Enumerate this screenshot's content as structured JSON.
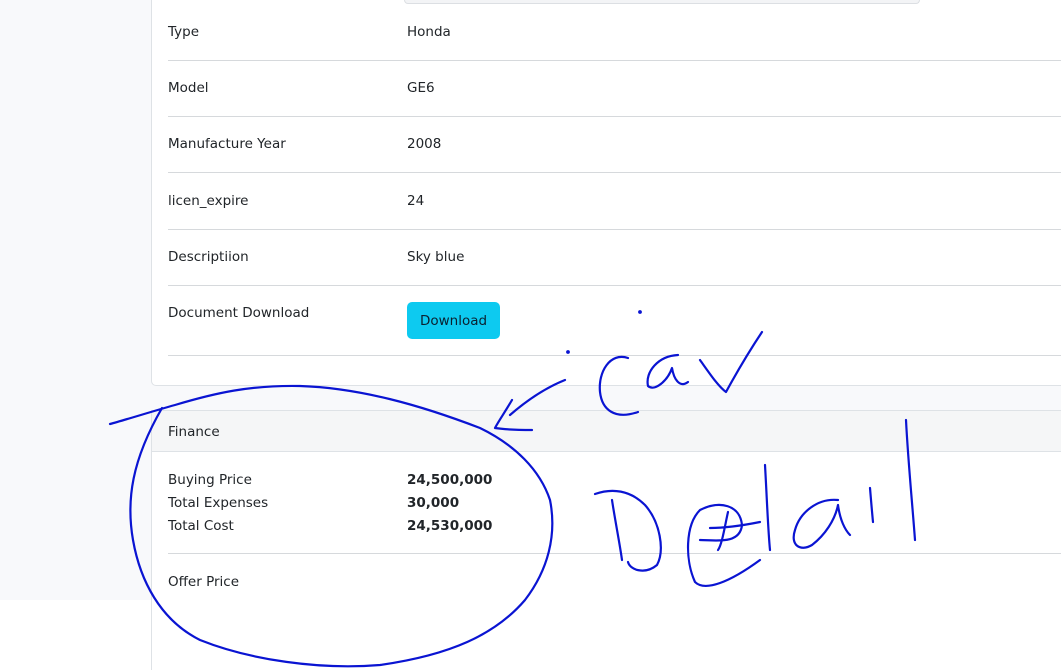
{
  "car_details": {
    "rows": [
      {
        "label": "Type",
        "value": "Honda"
      },
      {
        "label": "Model",
        "value": "GE6"
      },
      {
        "label": "Manufacture Year",
        "value": "2008"
      },
      {
        "label": "licen_expire",
        "value": "24"
      },
      {
        "label": "Descriptiion",
        "value": "Sky blue"
      }
    ],
    "document": {
      "label": "Document Download",
      "button_label": "Download"
    }
  },
  "finance": {
    "title": "Finance",
    "items": [
      {
        "label": "Buying Price",
        "value": "24,500,000"
      },
      {
        "label": "Total Expenses",
        "value": "30,000"
      },
      {
        "label": "Total Cost",
        "value": "24,530,000"
      }
    ],
    "offer_label": "Offer Price"
  },
  "annotation": {
    "color": "#0a14d2",
    "text_words": [
      "car",
      "Detail"
    ]
  }
}
